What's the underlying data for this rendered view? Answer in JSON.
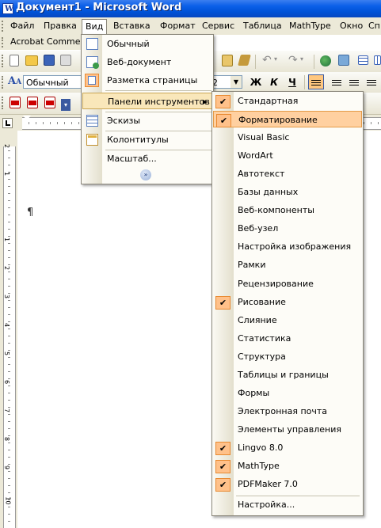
{
  "window": {
    "title": "Документ1 - Microsoft Word"
  },
  "menubar": {
    "items": [
      "Файл",
      "Правка",
      "Вид",
      "Вставка",
      "Формат",
      "Сервис",
      "Таблица",
      "MathType",
      "Окно",
      "Сп"
    ],
    "active": "Вид"
  },
  "acrobat_toolbar": {
    "label": "Acrobat Comments"
  },
  "formatting": {
    "style_value": "Обычный",
    "size_value": "2",
    "bold": "Ж",
    "italic": "К",
    "underline": "Ч"
  },
  "doc": {
    "paragraph_mark": "¶"
  },
  "vruler": {
    "numbers": [
      "2",
      "1",
      "1",
      "2",
      "3",
      "4",
      "5",
      "6",
      "7",
      "8",
      "9",
      "10"
    ]
  },
  "view_menu": {
    "items": [
      {
        "label": "Обычный",
        "icon": "normal-view-icon"
      },
      {
        "label": "Веб-документ",
        "icon": "web-layout-icon"
      },
      {
        "label": "Разметка страницы",
        "icon": "print-layout-icon"
      },
      {
        "label": "Панели инструментов",
        "icon": "",
        "submenu": true
      },
      {
        "label": "Эскизы",
        "icon": "thumbnails-icon"
      },
      {
        "label": "Колонтитулы",
        "icon": "header-footer-icon"
      },
      {
        "label": "Масштаб...",
        "icon": ""
      }
    ],
    "expand_icon": "chevron-double-down-icon"
  },
  "toolbars_menu": {
    "items": [
      {
        "label": "Стандартная",
        "checked": true
      },
      {
        "label": "Форматирование",
        "checked": true
      },
      {
        "label": "Visual Basic",
        "checked": false
      },
      {
        "label": "WordArt",
        "checked": false
      },
      {
        "label": "Автотекст",
        "checked": false
      },
      {
        "label": "Базы данных",
        "checked": false
      },
      {
        "label": "Веб-компоненты",
        "checked": false
      },
      {
        "label": "Веб-узел",
        "checked": false
      },
      {
        "label": "Настройка изображения",
        "checked": false
      },
      {
        "label": "Рамки",
        "checked": false
      },
      {
        "label": "Рецензирование",
        "checked": false
      },
      {
        "label": "Рисование",
        "checked": true
      },
      {
        "label": "Слияние",
        "checked": false
      },
      {
        "label": "Статистика",
        "checked": false
      },
      {
        "label": "Структура",
        "checked": false
      },
      {
        "label": "Таблицы и границы",
        "checked": false
      },
      {
        "label": "Формы",
        "checked": false
      },
      {
        "label": "Электронная почта",
        "checked": false
      },
      {
        "label": "Элементы управления",
        "checked": false
      },
      {
        "label": "Lingvo 8.0",
        "checked": true
      },
      {
        "label": "MathType",
        "checked": true
      },
      {
        "label": "PDFMaker 7.0",
        "checked": true
      },
      {
        "label": "Настройка...",
        "checked": false
      }
    ],
    "check_glyph": "✔"
  }
}
